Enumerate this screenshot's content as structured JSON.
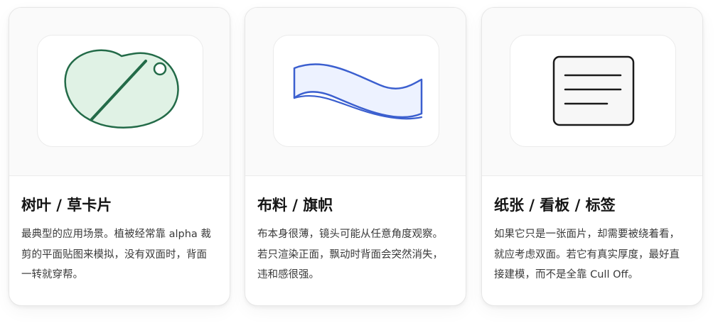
{
  "cards": [
    {
      "title": "树叶 / 草卡片",
      "description": "最典型的应用场景。植被经常靠 alpha 裁剪的平面贴图来模拟，没有双面时，背面一转就穿帮。",
      "icon": "leaf-icon",
      "accent": "#236b48",
      "fill": "#e0f2e5"
    },
    {
      "title": "布料 / 旗帜",
      "description": "布本身很薄，镜头可能从任意角度观察。若只渲染正面，飘动时背面会突然消失，违和感很强。",
      "icon": "flag-icon",
      "accent": "#3b5fcf",
      "fill": "#edf2ff"
    },
    {
      "title": "纸张 / 看板 / 标签",
      "description": "如果它只是一张面片，却需要被绕着看，就应考虑双面。若它有真实厚度，最好直接建模，而不是全靠 Cull Off。",
      "icon": "paper-sign-icon",
      "accent": "#1a1a1a",
      "fill": "#f7f7f7"
    }
  ]
}
